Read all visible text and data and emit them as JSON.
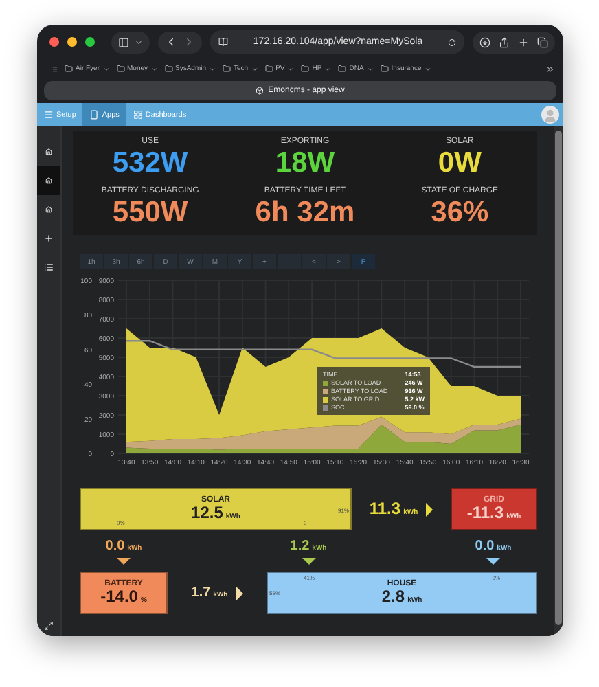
{
  "browser": {
    "url": "172.16.20.104/app/view?name=MySola",
    "tab_title": "Emoncms - app view",
    "bookmarks": [
      "Air Fyer",
      "Money",
      "SysAdmin",
      "Tech",
      "PV",
      "HP",
      "DNA",
      "Insurance"
    ]
  },
  "nav": [
    {
      "label": "Setup",
      "selected": false
    },
    {
      "label": "Apps",
      "selected": true
    },
    {
      "label": "Dashboards",
      "selected": false
    }
  ],
  "sidebar": [
    {
      "kind": "app",
      "selected": false
    },
    {
      "kind": "app",
      "selected": true
    },
    {
      "kind": "app",
      "selected": false
    },
    {
      "kind": "add",
      "selected": false
    },
    {
      "kind": "list",
      "selected": false
    }
  ],
  "stats": [
    {
      "label": "USE",
      "value": "532W",
      "color": "#3d9df0"
    },
    {
      "label": "EXPORTING",
      "value": "18W",
      "color": "#5cd43e"
    },
    {
      "label": "SOLAR",
      "value": "0W",
      "color": "#e8dc3c"
    },
    {
      "label": "BATTERY DISCHARGING",
      "value": "550W",
      "color": "#f08a5a"
    },
    {
      "label": "BATTERY TIME LEFT",
      "value": "6h 32m",
      "color": "#f08a5a"
    },
    {
      "label": "STATE OF CHARGE",
      "value": "36%",
      "color": "#f08a5a"
    }
  ],
  "range_buttons": [
    {
      "label": "1h",
      "selected": false
    },
    {
      "label": "3h",
      "selected": false
    },
    {
      "label": "6h",
      "selected": false
    },
    {
      "label": "D",
      "selected": false
    },
    {
      "label": "W",
      "selected": false
    },
    {
      "label": "M",
      "selected": false
    },
    {
      "label": "Y",
      "selected": false
    },
    {
      "label": "+",
      "selected": false
    },
    {
      "label": "-",
      "selected": false
    },
    {
      "label": "<",
      "selected": false
    },
    {
      "label": ">",
      "selected": false
    },
    {
      "label": "P",
      "selected": true
    }
  ],
  "chart": {
    "chart_data": {
      "type": "area",
      "stacked": true,
      "grid": true,
      "x": [
        "13:40",
        "13:50",
        "14:00",
        "14:10",
        "14:20",
        "14:30",
        "14:40",
        "14:50",
        "15:00",
        "15:10",
        "15:20",
        "15:30",
        "15:40",
        "15:50",
        "16:00",
        "16:10",
        "16:20",
        "16:30"
      ],
      "ylim": [
        0,
        9000
      ],
      "yticks": [
        0,
        1000,
        2000,
        3000,
        4000,
        5000,
        6000,
        7000,
        8000,
        9000
      ],
      "y2lim": [
        0,
        100
      ],
      "y2ticks": [
        0,
        20,
        40,
        60,
        80,
        100
      ],
      "series": [
        {
          "name": "SOLAR TO LOAD",
          "color": "#8fa83c",
          "values": [
            300,
            250,
            250,
            250,
            200,
            250,
            250,
            250,
            250,
            250,
            250,
            1500,
            600,
            600,
            500,
            1200,
            1200,
            1500
          ]
        },
        {
          "name": "BATTERY TO LOAD",
          "color": "#c9a97a",
          "values": [
            300,
            400,
            500,
            500,
            600,
            700,
            900,
            1000,
            1100,
            1200,
            1200,
            400,
            500,
            500,
            500,
            300,
            300,
            300
          ]
        },
        {
          "name": "SOLAR TO GRID",
          "color": "#d9cc42",
          "values": [
            5900,
            4850,
            4750,
            4250,
            1200,
            4550,
            3350,
            3750,
            4650,
            4550,
            4550,
            4600,
            4400,
            3900,
            2500,
            2000,
            1500,
            1200
          ]
        },
        {
          "name": "SOC",
          "color": "#8a8a8a",
          "type": "line",
          "axis": "y2",
          "values": [
            65,
            65,
            60,
            60,
            60,
            60,
            60,
            60,
            60,
            55,
            55,
            55,
            55,
            55,
            55,
            50,
            50,
            50
          ]
        }
      ]
    },
    "tooltip": {
      "time_label": "TIME",
      "time": "14:53",
      "values": [
        "246 W",
        "916 W",
        "5.2 kW",
        "59.0 %"
      ]
    }
  },
  "flow": {
    "solar": {
      "label": "SOLAR",
      "value": "12.5",
      "unit": "kWh",
      "notes": [
        "0%",
        "0",
        "91%"
      ]
    },
    "solar_to_grid": {
      "value": "11.3",
      "unit": "kWh"
    },
    "grid": {
      "label": "GRID",
      "value": "-11.3",
      "unit": "kWh"
    },
    "solar_to_battery": {
      "value": "0.0",
      "unit": "kWh"
    },
    "solar_to_house": {
      "value": "1.2",
      "unit": "kWh"
    },
    "grid_to_house": {
      "value": "0.0",
      "unit": "kWh"
    },
    "battery": {
      "label": "BATTERY",
      "value": "-14.0",
      "unit": "%"
    },
    "battery_to_house": {
      "value": "1.7",
      "unit": "kWh"
    },
    "house": {
      "label": "HOUSE",
      "value": "2.8",
      "unit": "kWh",
      "notes": [
        "41%",
        "0%",
        "59%"
      ]
    }
  }
}
